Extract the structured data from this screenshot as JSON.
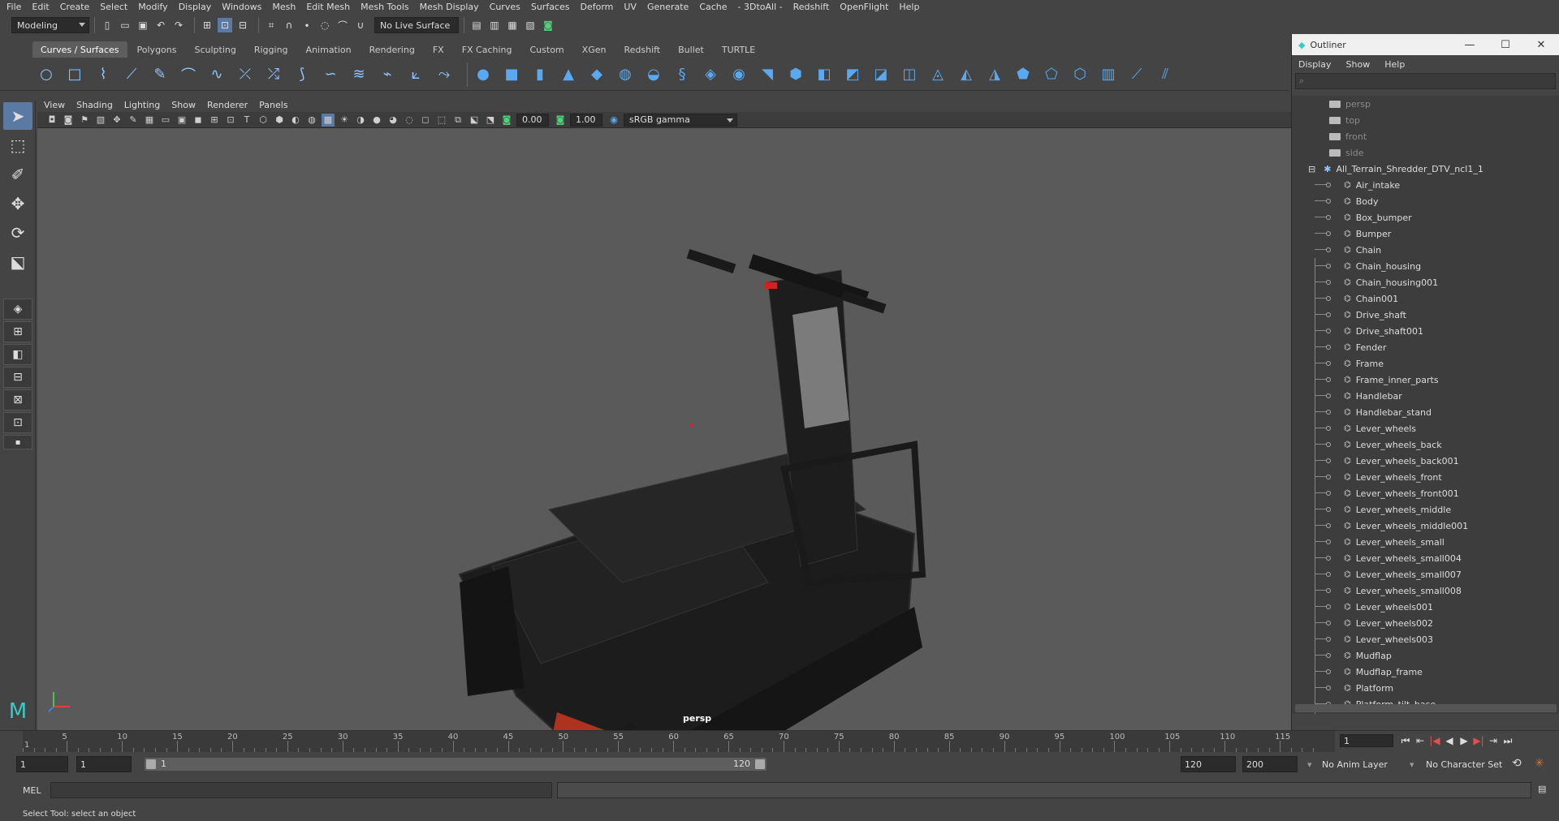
{
  "menubar": [
    "File",
    "Edit",
    "Create",
    "Select",
    "Modify",
    "Display",
    "Windows",
    "Mesh",
    "Edit Mesh",
    "Mesh Tools",
    "Mesh Display",
    "Curves",
    "Surfaces",
    "Deform",
    "UV",
    "Generate",
    "Cache",
    "- 3DtoAll -",
    "Redshift",
    "OpenFlight",
    "Help"
  ],
  "status": {
    "mode": "Modeling",
    "live_surface": "No Live Surface"
  },
  "shelf_tabs": [
    "Curves / Surfaces",
    "Polygons",
    "Sculpting",
    "Rigging",
    "Animation",
    "Rendering",
    "FX",
    "FX Caching",
    "Custom",
    "XGen",
    "Redshift",
    "Bullet",
    "TURTLE"
  ],
  "viewport": {
    "menu": [
      "View",
      "Shading",
      "Lighting",
      "Show",
      "Renderer",
      "Panels"
    ],
    "exposure": "0.00",
    "gamma_value": "1.00",
    "color_space": "sRGB gamma",
    "camera_label": "persp"
  },
  "outliner": {
    "title": "Outliner",
    "menu": [
      "Display",
      "Show",
      "Help"
    ],
    "cameras": [
      "persp",
      "top",
      "front",
      "side"
    ],
    "group": "All_Terrain_Shredder_DTV_ncl1_1",
    "items": [
      "Air_intake",
      "Body",
      "Box_bumper",
      "Bumper",
      "Chain",
      "Chain_housing",
      "Chain_housing001",
      "Chain001",
      "Drive_shaft",
      "Drive_shaft001",
      "Fender",
      "Frame",
      "Frame_inner_parts",
      "Handlebar",
      "Handlebar_stand",
      "Lever_wheels",
      "Lever_wheels_back",
      "Lever_wheels_back001",
      "Lever_wheels_front",
      "Lever_wheels_front001",
      "Lever_wheels_middle",
      "Lever_wheels_middle001",
      "Lever_wheels_small",
      "Lever_wheels_small004",
      "Lever_wheels_small007",
      "Lever_wheels_small008",
      "Lever_wheels001",
      "Lever_wheels002",
      "Lever_wheels003",
      "Mudflap",
      "Mudflap_frame",
      "Platform",
      "Platform_tilt_base"
    ]
  },
  "timeline": {
    "ticks": [
      "5",
      "10",
      "15",
      "20",
      "25",
      "30",
      "35",
      "40",
      "45",
      "50",
      "55",
      "60",
      "65",
      "70",
      "75",
      "80",
      "85",
      "90",
      "95",
      "100",
      "105",
      "110",
      "115"
    ],
    "first_label": "1",
    "current_frame": "1"
  },
  "range": {
    "start": "1",
    "playback_start": "1",
    "slider_start": "1",
    "slider_end": "120",
    "playback_end": "120",
    "end": "200",
    "anim_layer": "No Anim Layer",
    "char_set": "No Character Set"
  },
  "cmd": {
    "label": "MEL"
  },
  "help": "Select Tool: select an object"
}
